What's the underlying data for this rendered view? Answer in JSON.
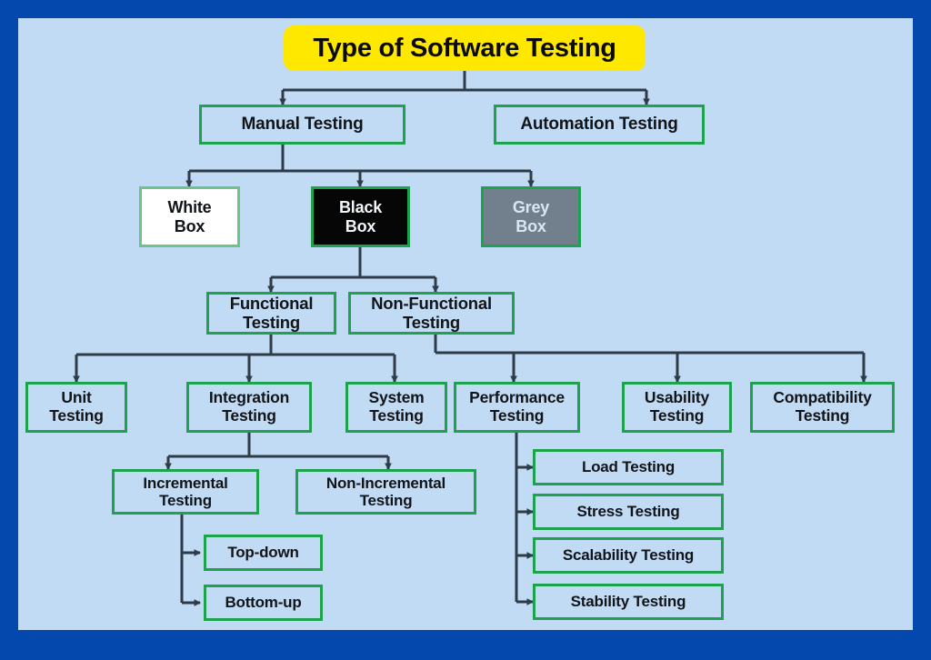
{
  "canvas": {
    "outer_border_color": "#0447AD",
    "background_color": "#C2DBF5",
    "connector_color": "#2F3B47",
    "box_border_color": "#1FA24E"
  },
  "title": {
    "label": "Type of Software Testing",
    "background_color": "#FFE800",
    "text_color": "#0A0A0A"
  },
  "level2": {
    "manual": "Manual Testing",
    "automation": "Automation Testing"
  },
  "level3": {
    "white_box": "White\nBox",
    "black_box": "Black\nBox",
    "grey_box": "Grey\nBox",
    "white_box_bg": "#FFFFFF",
    "black_box_bg": "#060606",
    "grey_box_bg": "#727F8C"
  },
  "level4": {
    "functional": "Functional\nTesting",
    "non_functional": "Non-Functional\nTesting"
  },
  "functional_children": [
    {
      "label": "Unit\nTesting"
    },
    {
      "label": "Integration\nTesting"
    },
    {
      "label": "System\nTesting"
    }
  ],
  "non_functional_children": [
    {
      "label": "Performance\nTesting"
    },
    {
      "label": "Usability\nTesting"
    },
    {
      "label": "Compatibility\nTesting"
    }
  ],
  "integration_children": [
    {
      "label": "Incremental\nTesting"
    },
    {
      "label": "Non-Incremental\nTesting"
    }
  ],
  "incremental_children": [
    {
      "label": "Top-down"
    },
    {
      "label": "Bottom-up"
    }
  ],
  "performance_children": [
    {
      "label": "Load Testing"
    },
    {
      "label": "Stress Testing"
    },
    {
      "label": "Scalability Testing"
    },
    {
      "label": "Stability Testing"
    }
  ]
}
